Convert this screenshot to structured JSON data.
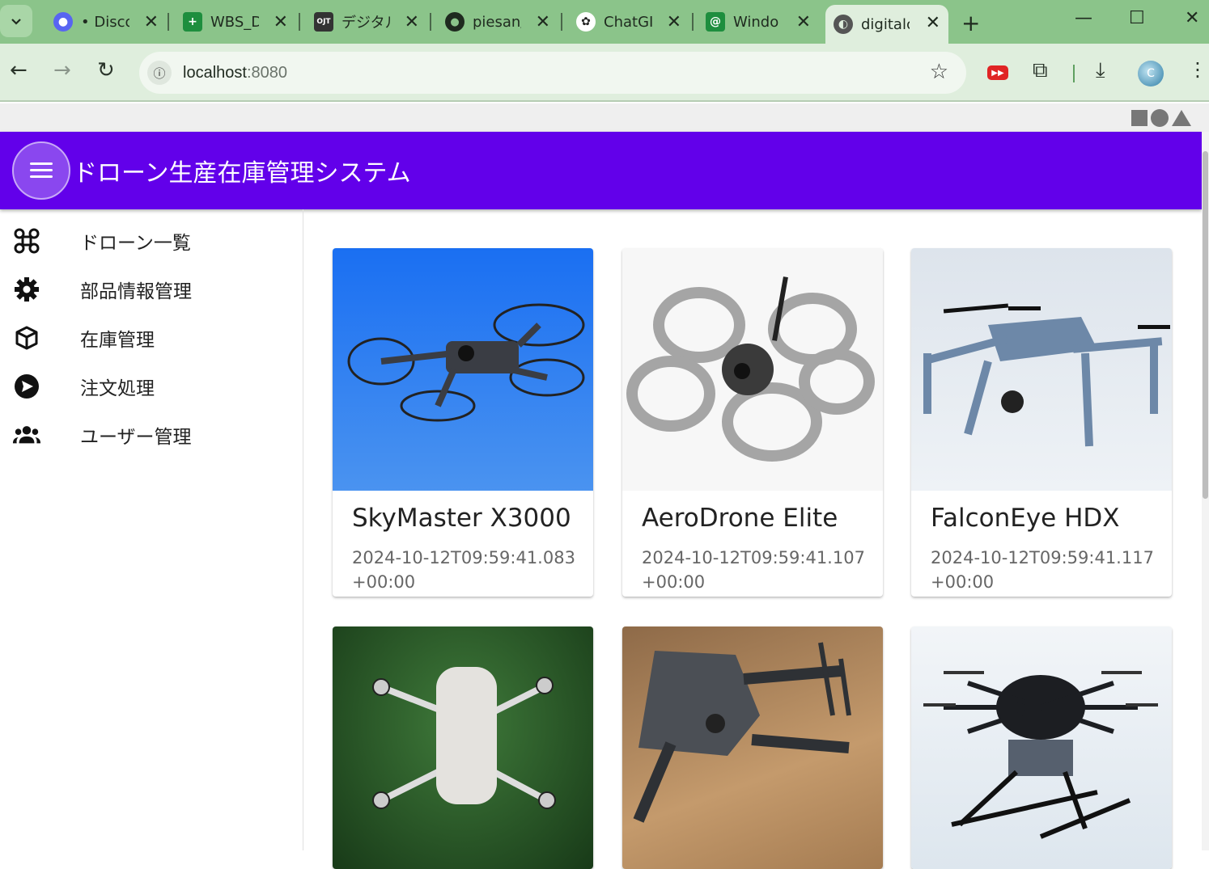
{
  "browser": {
    "tabs": [
      {
        "title": "• Disco",
        "icon": "discord-icon"
      },
      {
        "title": "WBS_D",
        "icon": "sheets-plus-icon"
      },
      {
        "title": "デジタル",
        "icon": "ojt-icon"
      },
      {
        "title": "piesan/",
        "icon": "github-icon"
      },
      {
        "title": "ChatGI",
        "icon": "openai-icon"
      },
      {
        "title": "Windo",
        "icon": "at-icon"
      },
      {
        "title": "digitalc",
        "icon": "globe-icon"
      }
    ],
    "url_host": "localhost",
    "url_port": ":8080"
  },
  "app": {
    "title": "ドローン生産在庫管理システム"
  },
  "sidebar": {
    "items": [
      {
        "label": "ドローン一覧",
        "icon": "drone-icon"
      },
      {
        "label": "部品情報管理",
        "icon": "gear-icon"
      },
      {
        "label": "在庫管理",
        "icon": "package-icon"
      },
      {
        "label": "注文処理",
        "icon": "send-icon"
      },
      {
        "label": "ユーザー管理",
        "icon": "users-icon"
      }
    ]
  },
  "cards": [
    {
      "name": "SkyMaster X3000",
      "date": "2024-10-12T09:59:41.083+00:00"
    },
    {
      "name": "AeroDrone Elite",
      "date": "2024-10-12T09:59:41.107+00:00"
    },
    {
      "name": "FalconEye HDX",
      "date": "2024-10-12T09:59:41.117+00:00"
    },
    {
      "name": "",
      "date": ""
    },
    {
      "name": "",
      "date": ""
    },
    {
      "name": "",
      "date": ""
    }
  ],
  "colors": {
    "appbar": "#6200ea",
    "tabbar": "#8bc48a"
  }
}
